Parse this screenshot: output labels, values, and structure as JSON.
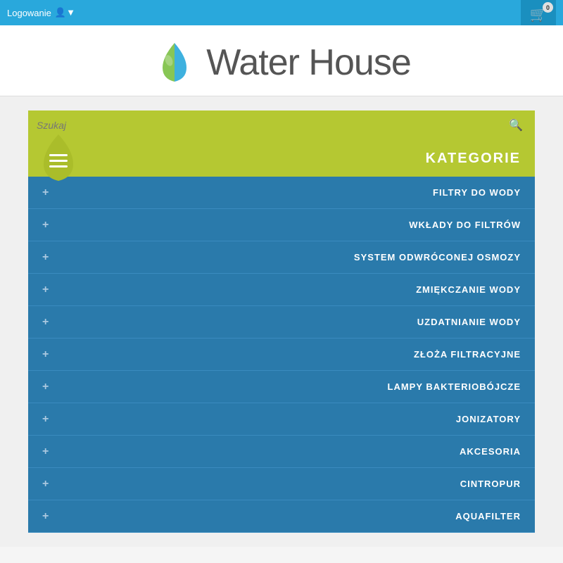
{
  "topbar": {
    "login_label": "Logowanie",
    "cart_count": "0",
    "cart_bg": "#1a8fbf"
  },
  "header": {
    "logo_text": "Water House"
  },
  "search": {
    "placeholder": "Szukaj"
  },
  "categories": {
    "title": "KATEGORIE",
    "items": [
      {
        "label": "FILTRY DO WODY"
      },
      {
        "label": "WKŁADY DO FILTRÓW"
      },
      {
        "label": "SYSTEM ODWRÓCONEJ OSMOZY"
      },
      {
        "label": "ZMIĘKCZANIE WODY"
      },
      {
        "label": "UZDATNIANIE WODY"
      },
      {
        "label": "ZŁOŻA FILTRACYJNE"
      },
      {
        "label": "LAMPY BAKTERIOBÓJCZE"
      },
      {
        "label": "JONIZATORY"
      },
      {
        "label": "AKCESORIA"
      },
      {
        "label": "CINTROPUR"
      },
      {
        "label": "AQUAFILTER"
      }
    ]
  },
  "colors": {
    "topbar": "#29a8dc",
    "accent_green": "#b5c832",
    "category_bg": "#2a7aab",
    "divider": "#3a8bbf"
  }
}
